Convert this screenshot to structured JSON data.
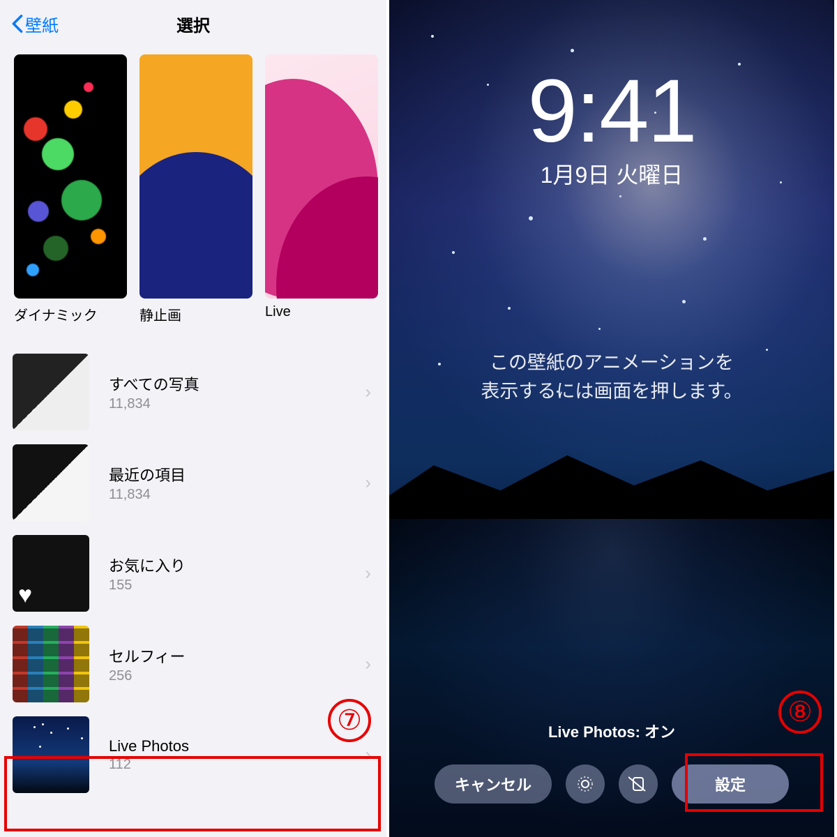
{
  "left": {
    "back_label": "壁紙",
    "title": "選択",
    "categories": [
      {
        "label": "ダイナミック"
      },
      {
        "label": "静止画"
      },
      {
        "label": "Live"
      }
    ],
    "albums": [
      {
        "title": "すべての写真",
        "count": "11,834"
      },
      {
        "title": "最近の項目",
        "count": "11,834"
      },
      {
        "title": "お気に入り",
        "count": "155"
      },
      {
        "title": "セルフィー",
        "count": "256"
      },
      {
        "title": "Live Photos",
        "count": "112"
      }
    ],
    "step_badge": "⑦"
  },
  "right": {
    "time": "9:41",
    "date": "1月9日 火曜日",
    "instruction_line1": "この壁紙のアニメーションを",
    "instruction_line2": "表示するには画面を押します。",
    "live_status": "Live Photos: オン",
    "cancel_label": "キャンセル",
    "set_label": "設定",
    "step_badge": "⑧"
  }
}
